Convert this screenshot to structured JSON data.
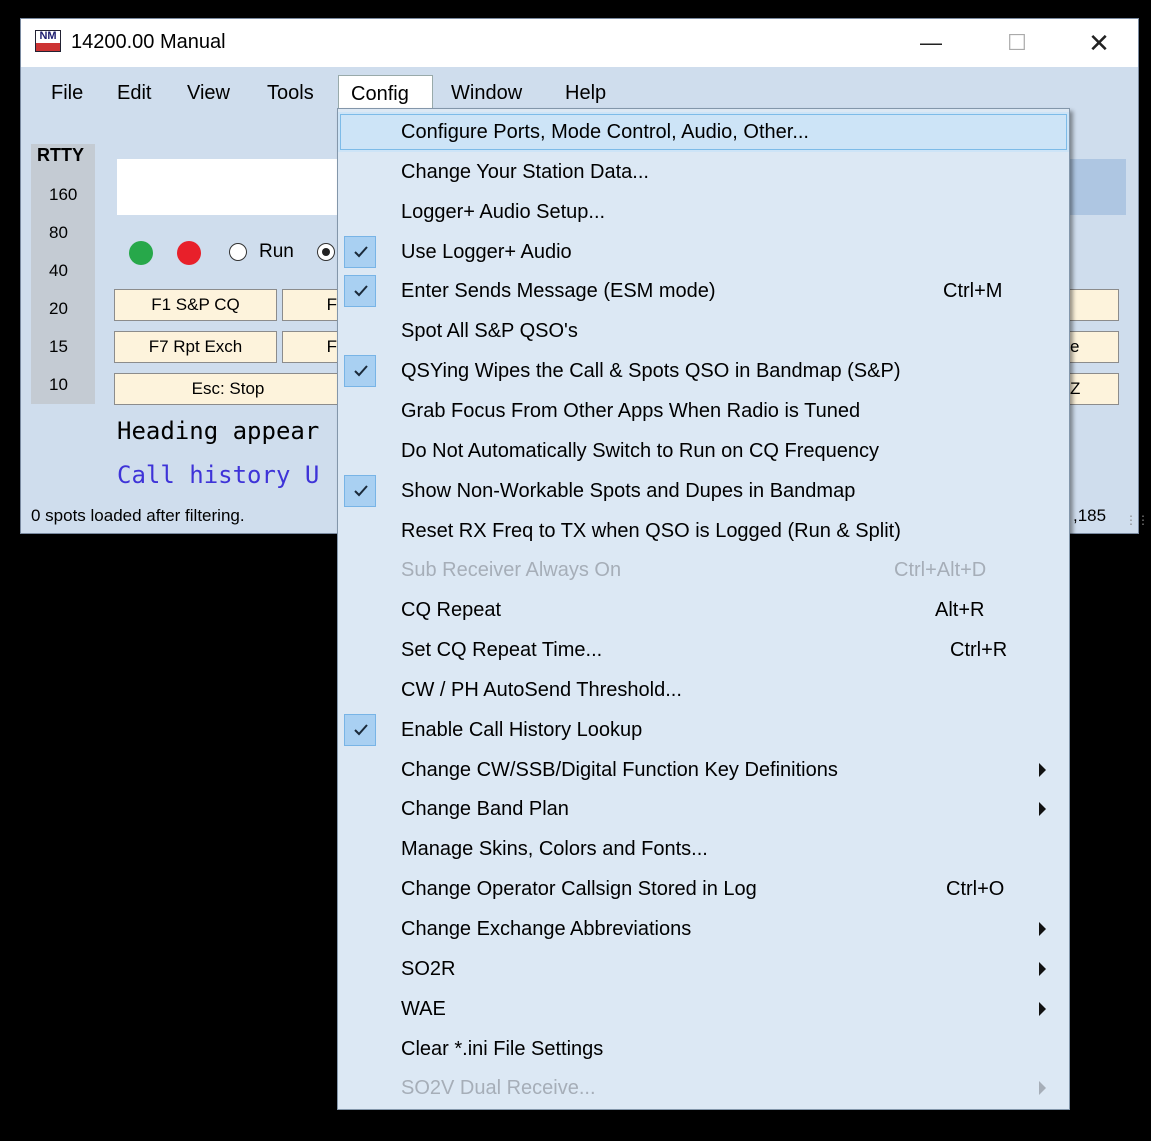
{
  "window": {
    "title": "14200.00 Manual",
    "logo_text": "N1MM",
    "menus": [
      "File",
      "Edit",
      "View",
      "Tools",
      "Config",
      "Window",
      "Help"
    ],
    "mode_label": "RTTY",
    "bands": [
      "160",
      "80",
      "40",
      "20",
      "15",
      "10"
    ],
    "run_label": "Run",
    "buttons": {
      "f1": "F1 S&P CQ",
      "f7": "F7 Rpt Exch",
      "esc": "Esc: Stop",
      "f_partial_1": "F",
      "f_partial_2": "F",
      "right_partial_1": "e",
      "right_partial_2": "Z"
    },
    "heading_text": "Heading appear",
    "call_history_text": "Call history U",
    "status_left": "0 spots loaded after filtering.",
    "status_right": ",185"
  },
  "config_menu": {
    "items": [
      {
        "label": "Configure Ports, Mode Control, Audio, Other...",
        "shortcut": "",
        "checked": false,
        "submenu": false,
        "disabled": false,
        "highlighted": true
      },
      {
        "label": "Change Your Station Data...",
        "shortcut": "",
        "checked": false,
        "submenu": false,
        "disabled": false
      },
      {
        "label": "Logger+ Audio Setup...",
        "shortcut": "",
        "checked": false,
        "submenu": false,
        "disabled": false
      },
      {
        "label": "Use Logger+ Audio",
        "shortcut": "",
        "checked": true,
        "submenu": false,
        "disabled": false
      },
      {
        "label": "Enter Sends Message (ESM mode)",
        "shortcut": "Ctrl+M",
        "checked": true,
        "submenu": false,
        "disabled": false
      },
      {
        "label": "Spot All S&P QSO's",
        "shortcut": "",
        "checked": false,
        "submenu": false,
        "disabled": false
      },
      {
        "label": "QSYing Wipes the Call & Spots QSO in Bandmap (S&P)",
        "shortcut": "",
        "checked": true,
        "submenu": false,
        "disabled": false
      },
      {
        "label": "Grab Focus From Other Apps When Radio is Tuned",
        "shortcut": "",
        "checked": false,
        "submenu": false,
        "disabled": false
      },
      {
        "label": "Do Not Automatically Switch to Run on CQ Frequency",
        "shortcut": "",
        "checked": false,
        "submenu": false,
        "disabled": false
      },
      {
        "label": "Show Non-Workable Spots and Dupes in Bandmap",
        "shortcut": "",
        "checked": true,
        "submenu": false,
        "disabled": false
      },
      {
        "label": "Reset RX Freq to TX when QSO is Logged (Run & Split)",
        "shortcut": "",
        "checked": false,
        "submenu": false,
        "disabled": false
      },
      {
        "label": "Sub Receiver Always On",
        "shortcut": "Ctrl+Alt+D",
        "checked": false,
        "submenu": false,
        "disabled": true
      },
      {
        "label": "CQ Repeat",
        "shortcut": "Alt+R",
        "checked": false,
        "submenu": false,
        "disabled": false
      },
      {
        "label": "Set CQ Repeat Time...",
        "shortcut": "Ctrl+R",
        "checked": false,
        "submenu": false,
        "disabled": false
      },
      {
        "label": "CW / PH AutoSend Threshold...",
        "shortcut": "",
        "checked": false,
        "submenu": false,
        "disabled": false
      },
      {
        "label": "Enable Call History Lookup",
        "shortcut": "",
        "checked": true,
        "submenu": false,
        "disabled": false
      },
      {
        "label": "Change CW/SSB/Digital Function Key Definitions",
        "shortcut": "",
        "checked": false,
        "submenu": true,
        "disabled": false
      },
      {
        "label": "Change Band Plan",
        "shortcut": "",
        "checked": false,
        "submenu": true,
        "disabled": false
      },
      {
        "label": "Manage Skins, Colors and Fonts...",
        "shortcut": "",
        "checked": false,
        "submenu": false,
        "disabled": false
      },
      {
        "label": "Change Operator Callsign Stored in Log",
        "shortcut": "Ctrl+O",
        "checked": false,
        "submenu": false,
        "disabled": false
      },
      {
        "label": "Change Exchange Abbreviations",
        "shortcut": "",
        "checked": false,
        "submenu": true,
        "disabled": false
      },
      {
        "label": "SO2R",
        "shortcut": "",
        "checked": false,
        "submenu": true,
        "disabled": false
      },
      {
        "label": "WAE",
        "shortcut": "",
        "checked": false,
        "submenu": true,
        "disabled": false
      },
      {
        "label": "Clear *.ini File Settings",
        "shortcut": "",
        "checked": false,
        "submenu": false,
        "disabled": false
      },
      {
        "label": "SO2V Dual Receive...",
        "shortcut": "",
        "checked": false,
        "submenu": true,
        "disabled": true
      }
    ]
  }
}
